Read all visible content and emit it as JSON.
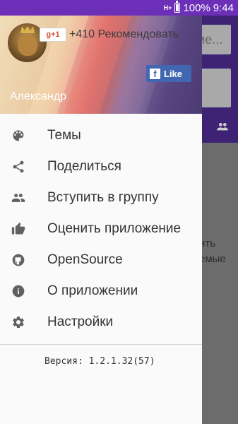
{
  "status_bar": {
    "network": "H+",
    "battery": "100%",
    "time": "9:44",
    "accent": "#6b2fb8"
  },
  "background_app": {
    "field_hint": "ме...",
    "text_lines": [
      "ить",
      "емые"
    ]
  },
  "header": {
    "gplus_label": "g+1",
    "recommend_text": "+410 Рекомендовать",
    "facebook_like": "Like",
    "facebook_icon": "f",
    "username": "Александр"
  },
  "menu": {
    "items": [
      {
        "label": "Темы",
        "icon": "palette-icon"
      },
      {
        "label": "Поделиться",
        "icon": "share-icon"
      },
      {
        "label": "Вступить в группу",
        "icon": "group-icon"
      },
      {
        "label": "Оценить приложение",
        "icon": "thumb-up-icon"
      },
      {
        "label": "OpenSource",
        "icon": "github-icon"
      },
      {
        "label": "О приложении",
        "icon": "info-icon"
      },
      {
        "label": "Настройки",
        "icon": "gear-icon"
      }
    ]
  },
  "footer": {
    "version": "Версия: 1.2.1.32(57)"
  }
}
